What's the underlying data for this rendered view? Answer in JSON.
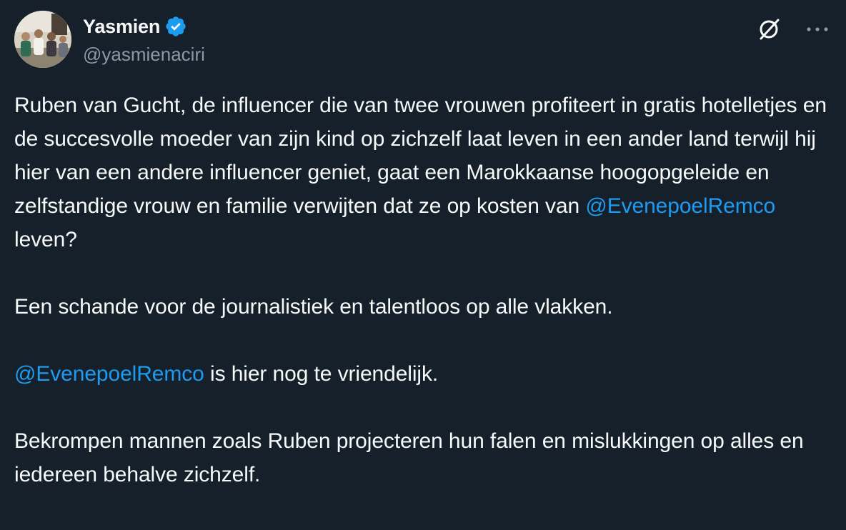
{
  "author": {
    "display_name": "Yasmien",
    "handle": "@yasmienaciri",
    "verified": true,
    "avatar_icon": "avatar-photo"
  },
  "actions": {
    "grok_icon": "grok-icon",
    "more_icon": "more-horizontal-icon"
  },
  "tweet": {
    "p1": {
      "text_before": "Ruben van Gucht, de influencer die van twee vrouwen profiteert in gratis hotelletjes en de succesvolle moeder van zijn kind op zichzelf laat leven in een ander land terwijl hij hier van een andere influencer geniet, gaat een Marokkaanse hoogopgeleide en zelfstandige vrouw en familie verwijten dat ze op kosten van ",
      "mention": "@EvenepoelRemco",
      "text_after": " leven?"
    },
    "p2": "Een schande voor de journalistiek en talentloos op alle vlakken.",
    "p3": {
      "mention": "@EvenepoelRemco",
      "text_after": " is hier nog te vriendelijk."
    },
    "p4": "Bekrompen mannen zoals Ruben projecteren hun falen en mislukkingen op alles en iedereen behalve zichzelf."
  },
  "colors": {
    "background": "#15202b",
    "text": "#f7f9f9",
    "secondary": "#8b98a5",
    "accent": "#1d9bf0"
  }
}
